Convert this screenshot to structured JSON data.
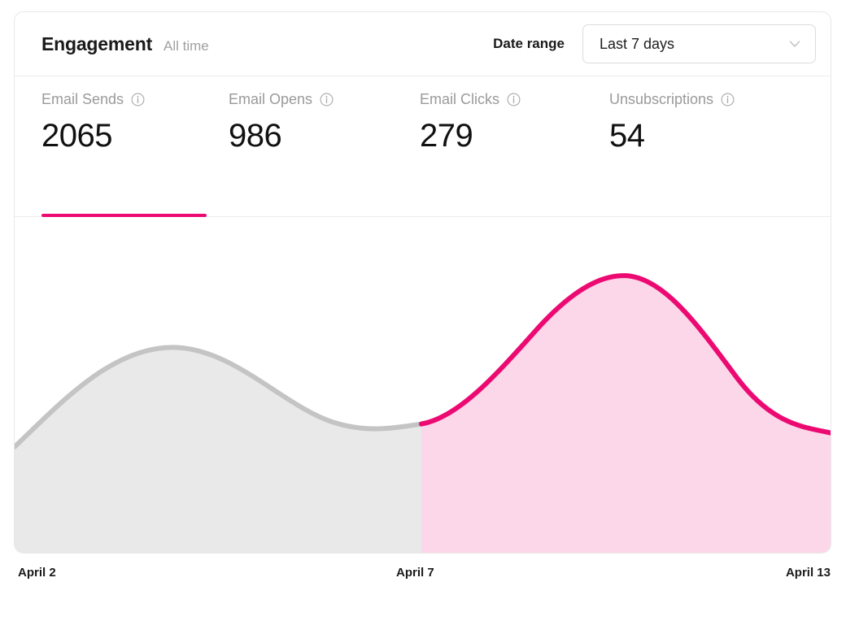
{
  "header": {
    "title": "Engagement",
    "subtitle": "All time",
    "daterange_label": "Date range",
    "daterange_value": "Last 7 days",
    "chevron_icon": "chevron-down-icon"
  },
  "metrics": [
    {
      "label": "Email Sends",
      "value": "2065",
      "info_icon": "info-icon",
      "active": true
    },
    {
      "label": "Email Opens",
      "value": "986",
      "info_icon": "info-icon",
      "active": false
    },
    {
      "label": "Email Clicks",
      "value": "279",
      "info_icon": "info-icon",
      "active": false
    },
    {
      "label": "Unsubscriptions",
      "value": "54",
      "info_icon": "info-icon",
      "active": false
    }
  ],
  "colors": {
    "accent": "#ec0a72",
    "accent_fill": "#fcd7e9",
    "past_line": "#c4c4c4",
    "past_fill": "#e9e9e9",
    "text_primary": "#1a1a1a",
    "text_muted": "#9a9a9a",
    "border": "#e8e8e8"
  },
  "chart_data": {
    "type": "area",
    "title": "Engagement",
    "xlabel": "",
    "ylabel": "",
    "grid": false,
    "legend": "none",
    "x_tick_labels": [
      "April 2",
      "April 7",
      "April 13"
    ],
    "x_tick_positions": [
      0,
      45.5,
      100
    ],
    "split_at_label": "April 7",
    "split_fraction": 0.455,
    "series": [
      {
        "name": "Email Sends (past)",
        "line_color": "#c4c4c4",
        "fill_color": "#e9e9e9",
        "x": [
          0,
          10,
          20,
          30,
          40,
          45.5
        ],
        "y": [
          19,
          41,
          47,
          33,
          22,
          21
        ]
      },
      {
        "name": "Email Sends (recent)",
        "line_color": "#ec0a72",
        "fill_color": "#fcd7e9",
        "x": [
          45.5,
          55,
          65,
          75,
          85,
          95,
          100
        ],
        "y": [
          21,
          41,
          62,
          69,
          62,
          38,
          26
        ]
      }
    ],
    "ylim": [
      0,
      100
    ],
    "y_axis_visible": false
  }
}
